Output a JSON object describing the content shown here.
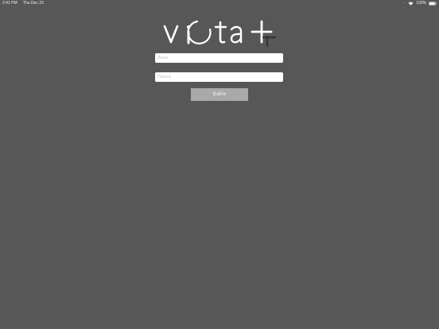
{
  "status_bar": {
    "time": "2:41 PM",
    "date": "Thu Dec 23",
    "battery": "100%"
  },
  "logo": {
    "text": "vita +"
  },
  "form": {
    "login_placeholder": "Логин",
    "password_placeholder": "Пароль",
    "submit_label": "Войти"
  },
  "colors": {
    "background": "#575757",
    "button": "#a9a9a9",
    "logo": "#ffffff"
  }
}
